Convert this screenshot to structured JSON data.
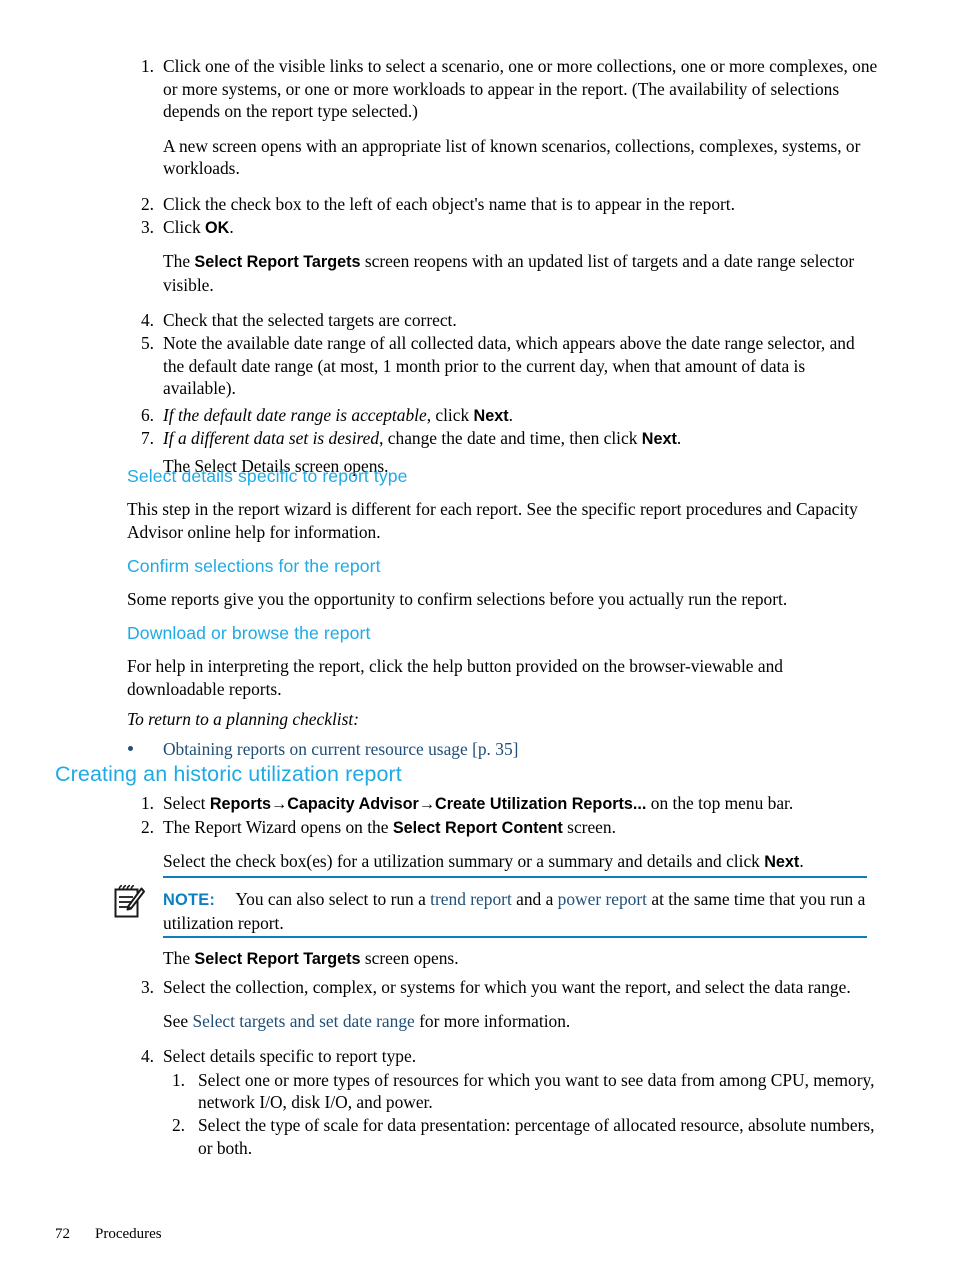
{
  "page": {
    "footer_page_number": "72",
    "footer_chapter": "Procedures"
  },
  "colors": {
    "heading_blue": "#1eaae5",
    "link_navy": "#1f4e79",
    "note_blue": "#0b7fc0",
    "body_black": "#000000"
  },
  "steps_top": {
    "items": [
      {
        "num": "1.",
        "text": "Click one of the visible links to select a scenario, one or more collections, one or more complexes, one or more systems, or one or more workloads to appear in the report. (The availability of selections depends on the report type selected.)",
        "continuation": "A new screen opens with an appropriate list of known scenarios, collections, complexes, systems, or workloads."
      },
      {
        "num": "2.",
        "text": "Click the check box to the left of each object's name that is to appear in the report."
      },
      {
        "num": "3.",
        "text_before": "Click ",
        "bold": "OK",
        "text_after": ".",
        "continuation_before": "The ",
        "continuation_bold": "Select Report Targets",
        "continuation_after": " screen reopens with an updated list of targets and a date range selector visible."
      },
      {
        "num": "4.",
        "text": "Check that the selected targets are correct."
      },
      {
        "num": "5.",
        "text": "Note the available date range of all collected data, which appears above the date range selector, and the default date range (at most, 1 month prior to the current day, when that amount of data is available)."
      },
      {
        "num": "6.",
        "italic": "If the default date range is acceptable",
        "text_before": ", click ",
        "bold": "Next",
        "text_after": "."
      },
      {
        "num": "7.",
        "italic": "If a different data set is desired",
        "text_before": ", change the date and time, then click ",
        "bold": "Next",
        "text_after": ".",
        "continuation": "The Select Details screen opens."
      }
    ]
  },
  "subsections": [
    {
      "heading": "Select details specific to report type",
      "paragraph": "This step in the report wizard is different for each report. See the specific report procedures and Capacity Advisor online help for information."
    },
    {
      "heading": "Confirm selections for the report",
      "paragraph": "Some reports give you the opportunity to confirm selections before you actually run the report."
    },
    {
      "heading": "Download or browse the report",
      "paragraph": "For help in interpreting the report, click the help button provided on the browser-viewable and downloadable reports.",
      "italic_lead": "To return to a planning checklist:",
      "bullets": [
        {
          "link_text": "Obtaining reports on current resource usage",
          "page_ref": " [p. 35]"
        }
      ]
    }
  ],
  "section": {
    "heading": "Creating an historic utilization report",
    "steps": [
      {
        "num": "1.",
        "text_before": "Select ",
        "bold": "Reports→Capacity Advisor→Create Utilization Reports...",
        "text_after": " on the top menu bar."
      },
      {
        "num": "2.",
        "text_before": "The Report Wizard opens on the ",
        "bold": "Select Report Content",
        "text_after": " screen.",
        "continuation_before": "Select the check box(es) for a utilization summary or a summary and details and click ",
        "continuation_bold": "Next",
        "continuation_after": "."
      },
      {
        "num": "3.",
        "text": "Select the collection, complex, or systems for which you want the report, and select the data range.",
        "continuation_before": "See ",
        "continuation_link": "Select targets and set date range",
        "continuation_after": " for more information."
      },
      {
        "num": "4.",
        "text": "Select details specific to report type.",
        "subitems": [
          {
            "num": "1.",
            "text": "Select one or more types of resources for which you want to see data from among CPU, memory, network I/O, disk I/O, and power."
          },
          {
            "num": "2.",
            "text": "Select the type of scale for data presentation: percentage of allocated resource, absolute numbers, or both."
          }
        ]
      }
    ]
  },
  "note": {
    "icon": "note-pad-pencil-icon",
    "label": "NOTE:",
    "text_before": "You can also select to run a ",
    "link1": "trend report",
    "text_middle": " and a ",
    "link2": "power report",
    "text_after": " at the same time that you run a utilization report."
  },
  "after_note": {
    "text_before": "The ",
    "bold": "Select Report Targets",
    "text_after": " screen opens."
  }
}
